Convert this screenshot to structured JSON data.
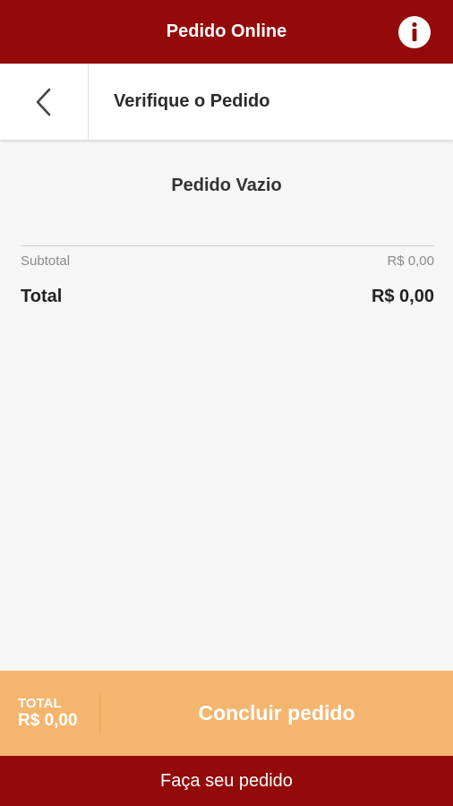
{
  "app_bar": {
    "title": "Pedido Online",
    "info_icon": "info-icon"
  },
  "sub_header": {
    "back_icon": "chevron-left-icon",
    "title": "Verifique o Pedido"
  },
  "order": {
    "empty_message": "Pedido Vazio",
    "subtotal_label": "Subtotal",
    "subtotal_value": "R$ 0,00",
    "total_label": "Total",
    "total_value": "R$ 0,00"
  },
  "action_bar": {
    "total_label": "TOTAL",
    "total_value": "R$ 0,00",
    "conclude_label": "Concluir pedido"
  },
  "bottom_bar": {
    "label": "Faça seu pedido"
  },
  "colors": {
    "brand_red": "#930a09",
    "accent_orange": "#f4b56e",
    "background": "#f6f6f6"
  }
}
